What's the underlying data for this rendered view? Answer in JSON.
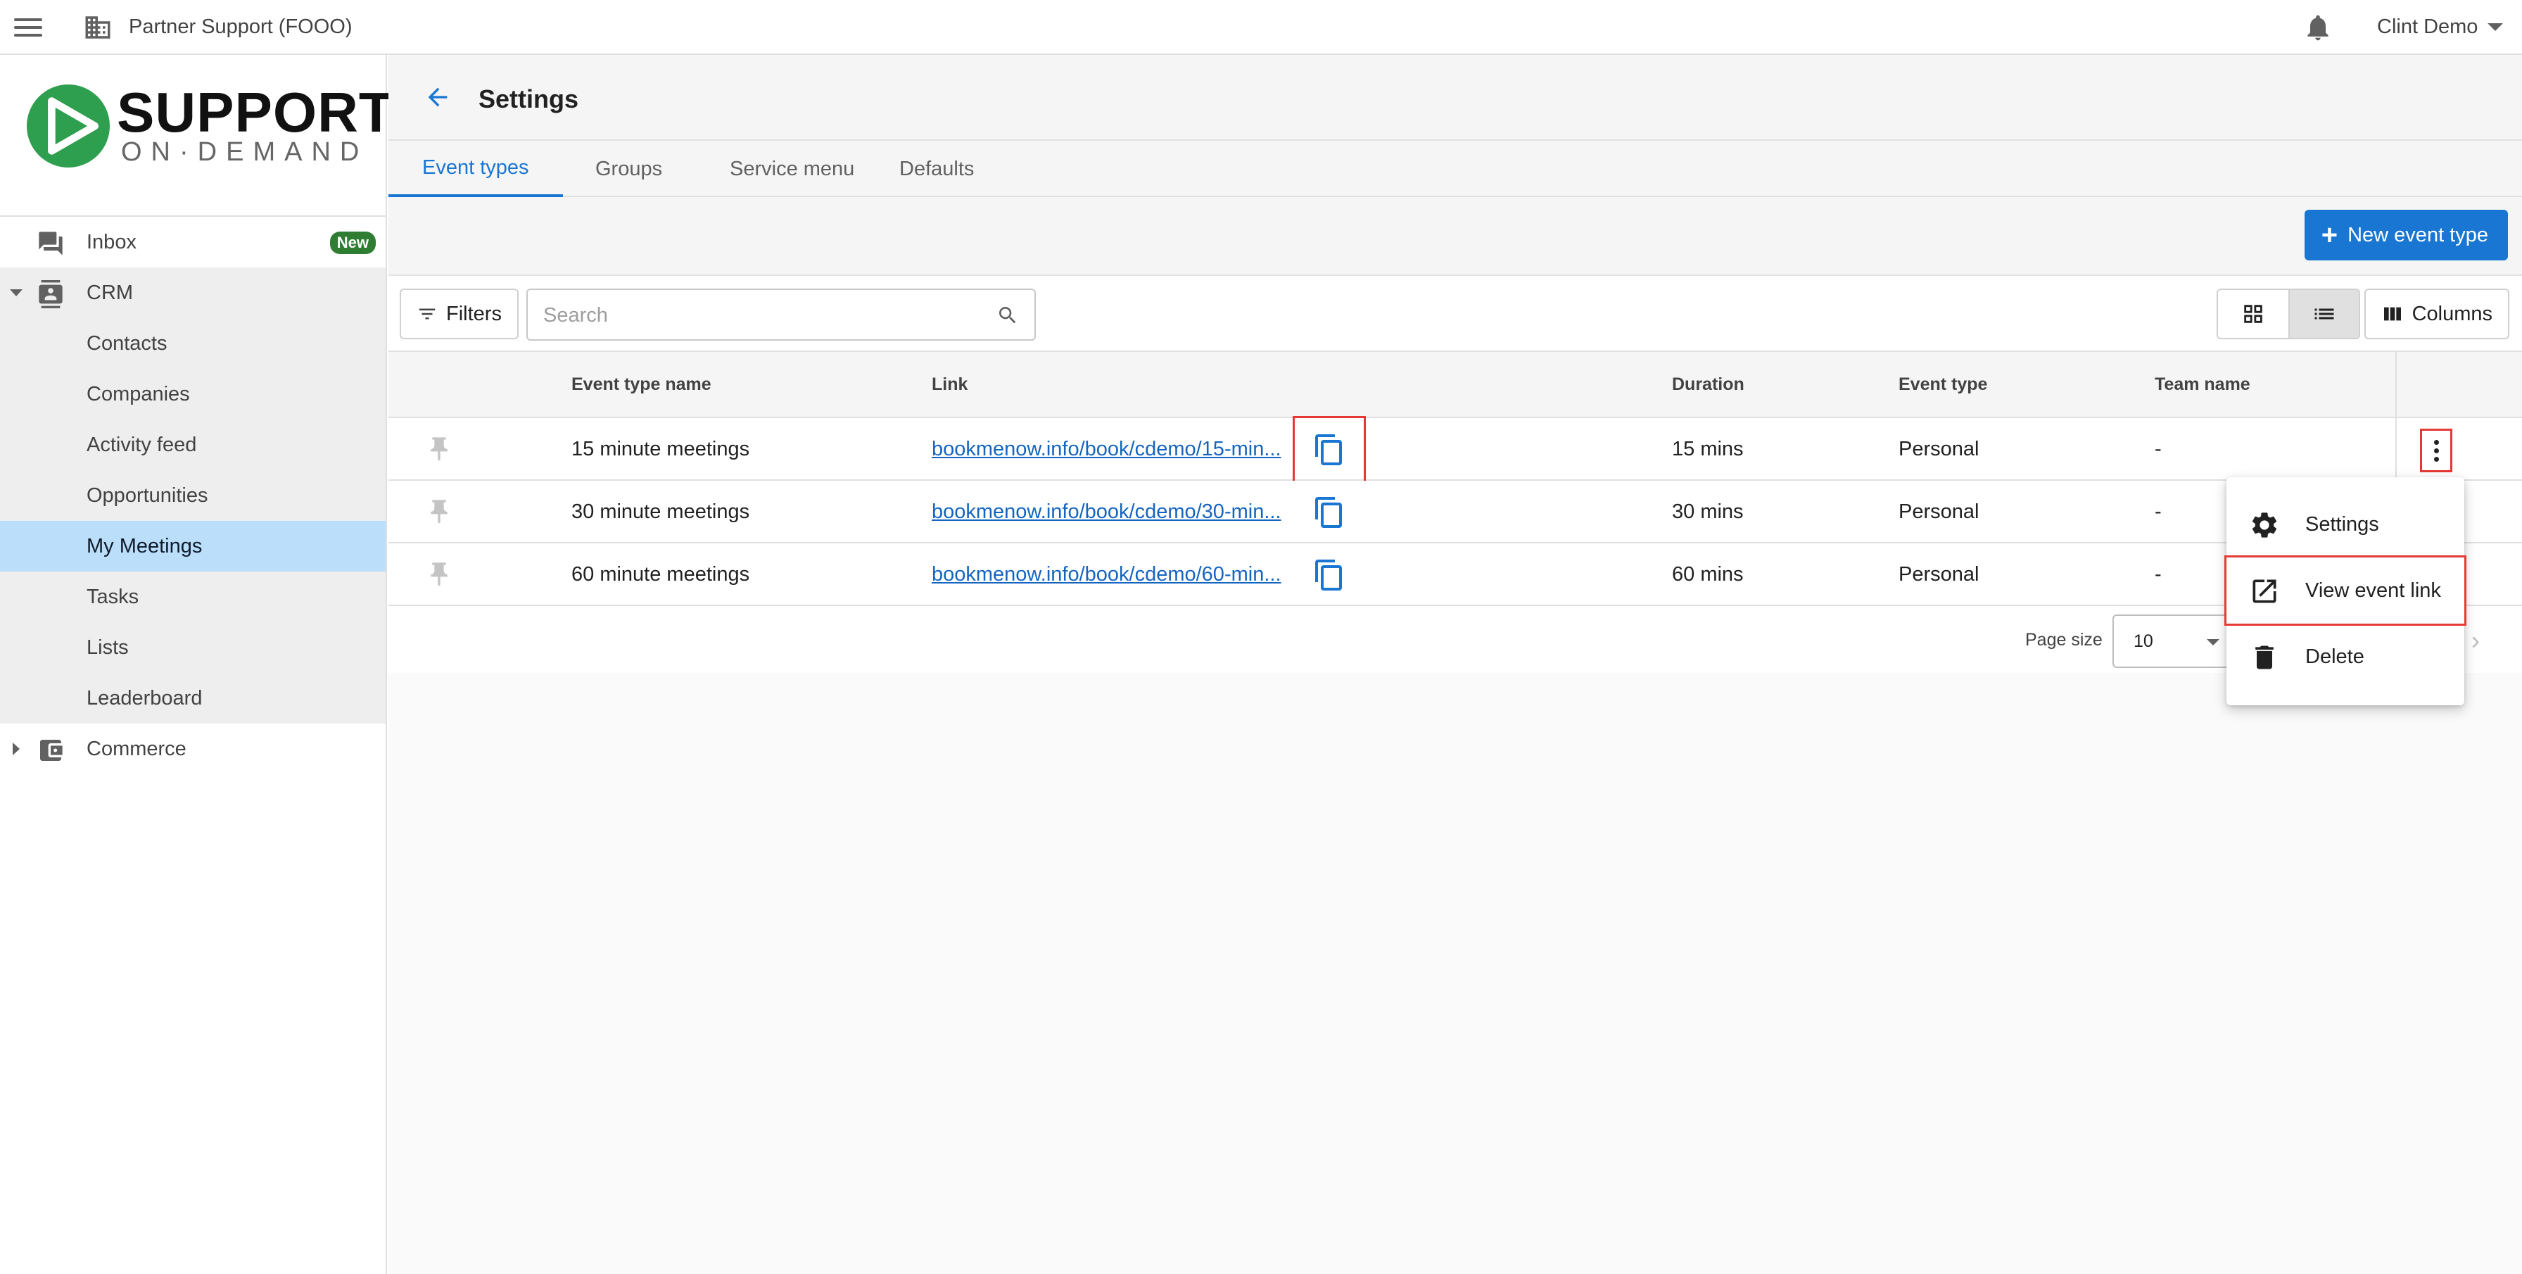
{
  "topbar": {
    "partner": "Partner Support (FOOO)",
    "user": "Clint Demo"
  },
  "logo": {
    "line1": "SUPPORT",
    "line2": "ON·DEMAND",
    "brand_color": "#2e9e4f"
  },
  "sidebar": {
    "items": [
      {
        "label": "Inbox",
        "badge": "New"
      },
      {
        "label": "CRM"
      },
      {
        "label": "Contacts"
      },
      {
        "label": "Companies"
      },
      {
        "label": "Activity feed"
      },
      {
        "label": "Opportunities"
      },
      {
        "label": "My Meetings"
      },
      {
        "label": "Tasks"
      },
      {
        "label": "Lists"
      },
      {
        "label": "Leaderboard"
      },
      {
        "label": "Commerce"
      }
    ]
  },
  "header": {
    "title": "Settings"
  },
  "tabs": [
    {
      "label": "Event types"
    },
    {
      "label": "Groups"
    },
    {
      "label": "Service menu"
    },
    {
      "label": "Defaults"
    }
  ],
  "toolbar": {
    "new_label": "New event type",
    "filters_label": "Filters",
    "search_placeholder": "Search",
    "columns_label": "Columns"
  },
  "table": {
    "headers": {
      "name": "Event type name",
      "link": "Link",
      "duration": "Duration",
      "event_type": "Event type",
      "team": "Team name"
    },
    "rows": [
      {
        "name": "15 minute meetings",
        "link": "bookmenow.info/book/cdemo/15-min...",
        "duration": "15 mins",
        "event_type": "Personal",
        "team": "-"
      },
      {
        "name": "30 minute meetings",
        "link": "bookmenow.info/book/cdemo/30-min...",
        "duration": "30 mins",
        "event_type": "Personal",
        "team": "-"
      },
      {
        "name": "60 minute meetings",
        "link": "bookmenow.info/book/cdemo/60-min...",
        "duration": "60 mins",
        "event_type": "Personal",
        "team": "-"
      }
    ]
  },
  "pager": {
    "page_size_label": "Page size",
    "page_size": "10"
  },
  "context_menu": {
    "items": [
      {
        "label": "Settings",
        "icon": "gear-icon"
      },
      {
        "label": "View event link",
        "icon": "open-in-new-icon"
      },
      {
        "label": "Delete",
        "icon": "trash-icon"
      }
    ]
  },
  "colors": {
    "accent": "#1976d2",
    "active_nav": "#bbdefb",
    "badge": "#2e7d32",
    "highlight_outline": "#e53935"
  }
}
